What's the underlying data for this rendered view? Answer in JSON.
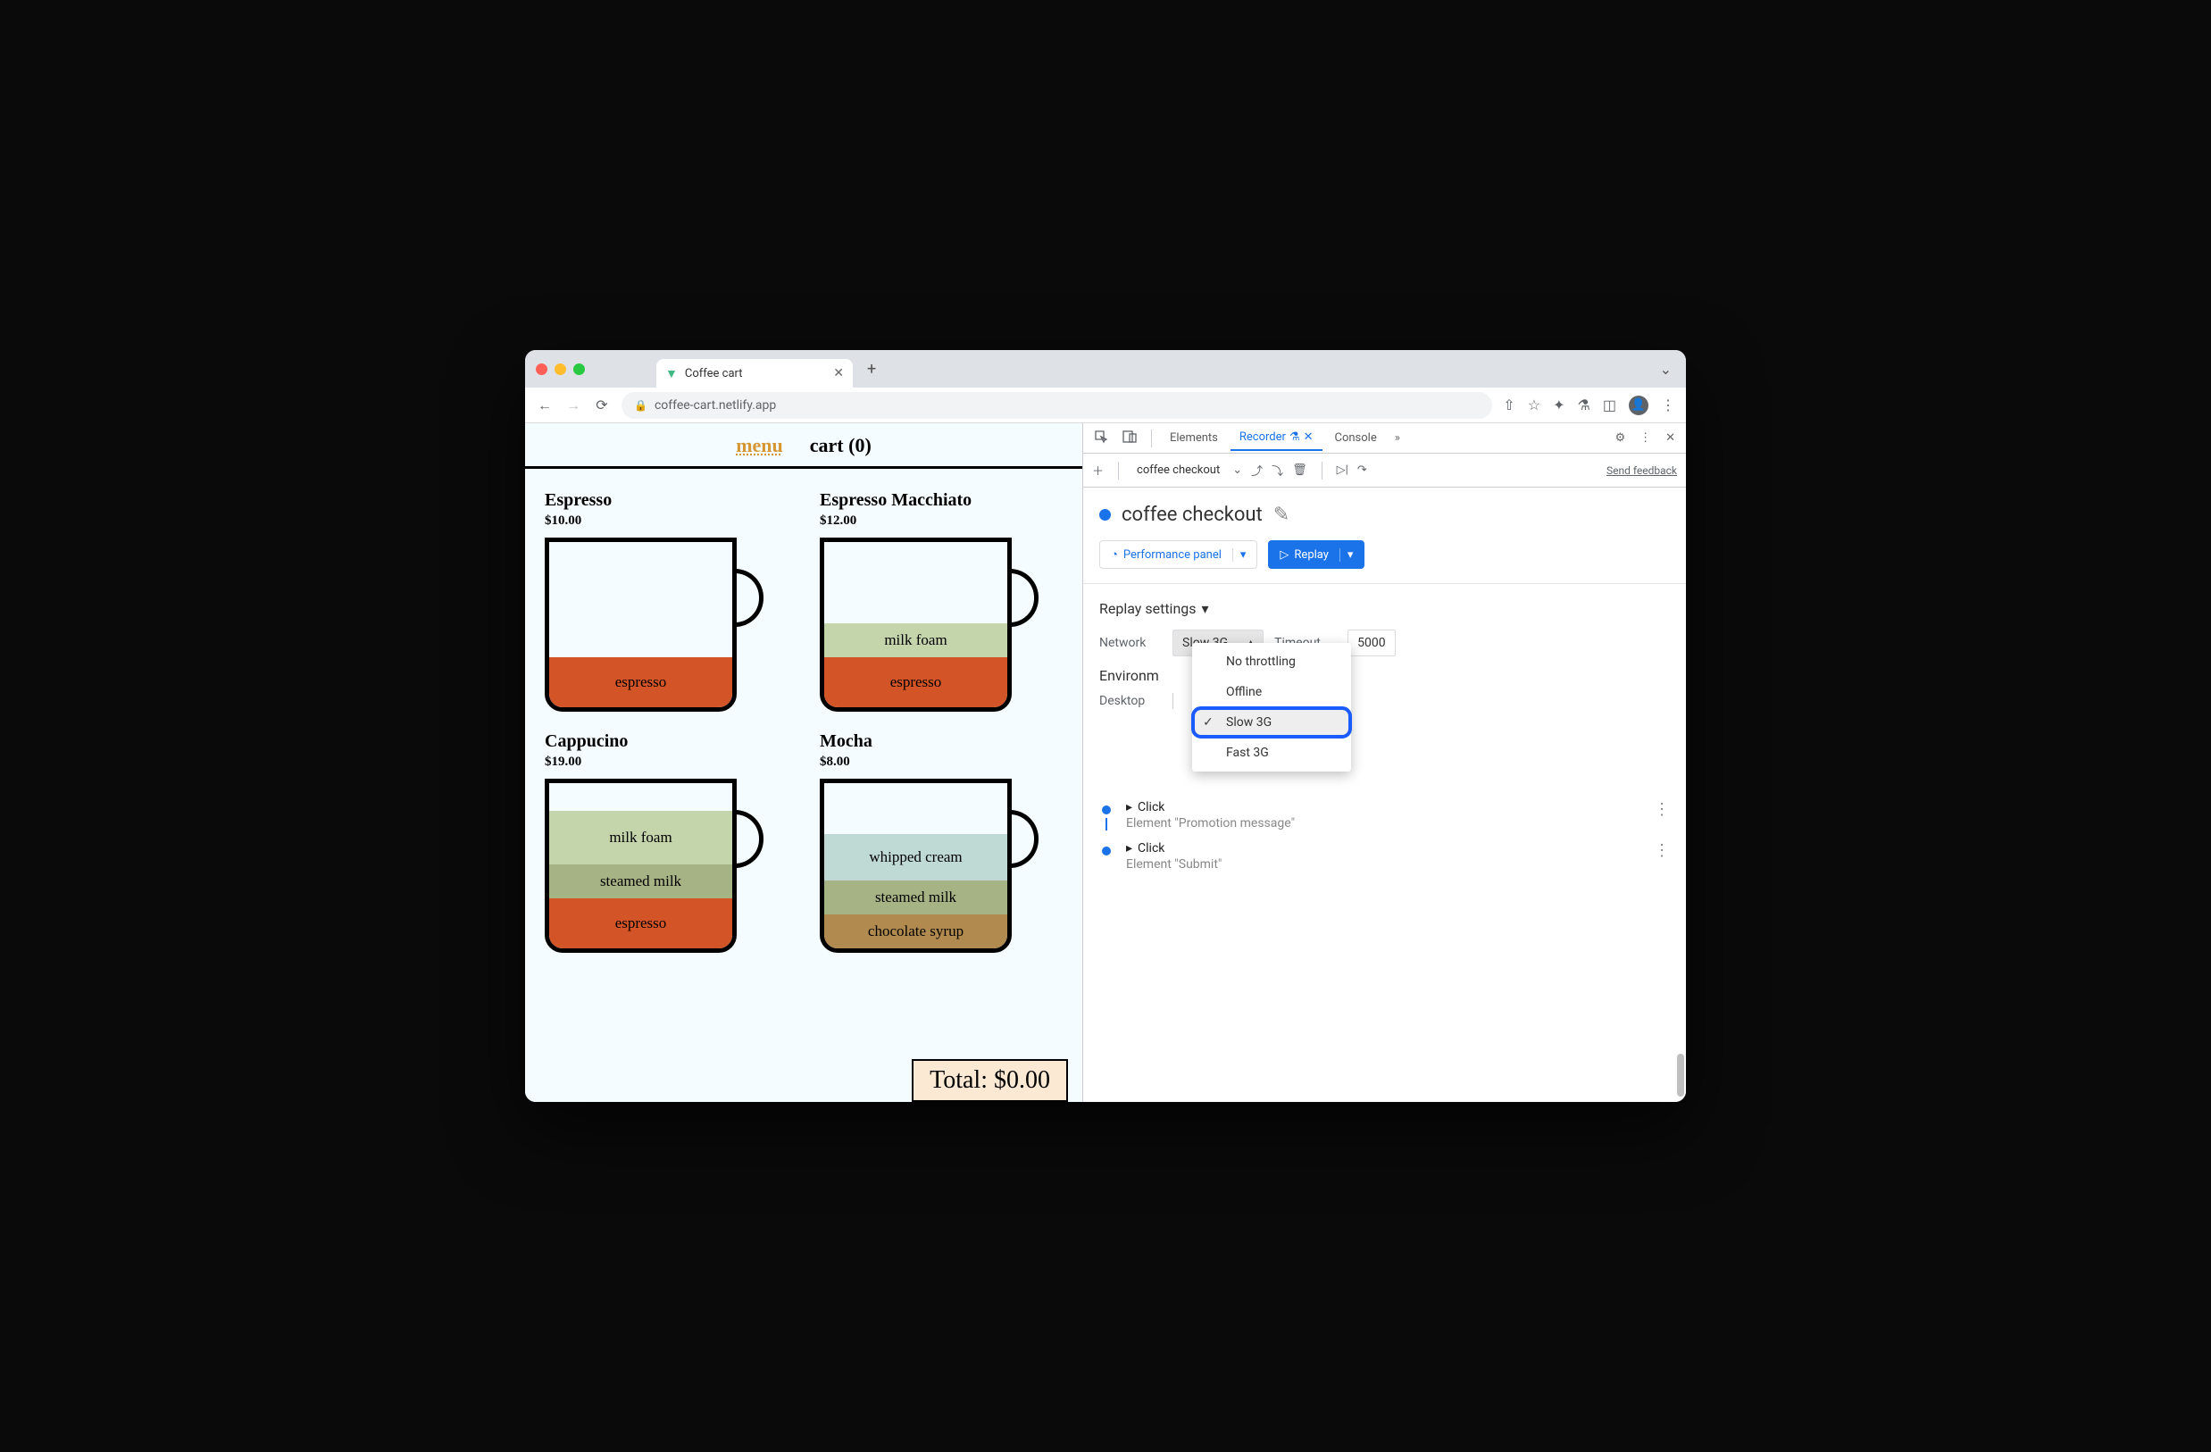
{
  "browser": {
    "tab_title": "Coffee cart",
    "url": "coffee-cart.netlify.app"
  },
  "page": {
    "nav_menu": "menu",
    "nav_cart": "cart (0)",
    "total": "Total: $0.00",
    "items": {
      "espresso": {
        "name": "Espresso",
        "price": "$10.00",
        "layers": [
          "espresso"
        ]
      },
      "macchiato": {
        "name": "Espresso Macchiato",
        "price": "$12.00",
        "layers": [
          "milk foam",
          "espresso"
        ]
      },
      "cappucino": {
        "name": "Cappucino",
        "price": "$19.00",
        "layers": [
          "milk foam",
          "steamed milk",
          "espresso"
        ]
      },
      "mocha": {
        "name": "Mocha",
        "price": "$8.00",
        "layers": [
          "whipped cream",
          "steamed milk",
          "chocolate syrup"
        ]
      }
    }
  },
  "devtools": {
    "tabs": {
      "elements": "Elements",
      "recorder": "Recorder",
      "console": "Console"
    },
    "feedback": "Send feedback",
    "recording_name": "coffee checkout",
    "title": "coffee checkout",
    "perf_button": "Performance panel",
    "replay_button": "Replay",
    "settings_title": "Replay settings",
    "network_label": "Network",
    "network_value": "Slow 3G",
    "timeout_label": "Timeout",
    "timeout_value": "5000",
    "env_title": "Environm",
    "desktop": "Desktop",
    "dropdown": {
      "none": "No throttling",
      "offline": "Offline",
      "slow": "Slow 3G",
      "fast": "Fast 3G"
    },
    "steps": [
      {
        "action": "Click",
        "desc": "Element \"Promotion message\""
      },
      {
        "action": "Click",
        "desc": "Element \"Submit\""
      }
    ]
  }
}
